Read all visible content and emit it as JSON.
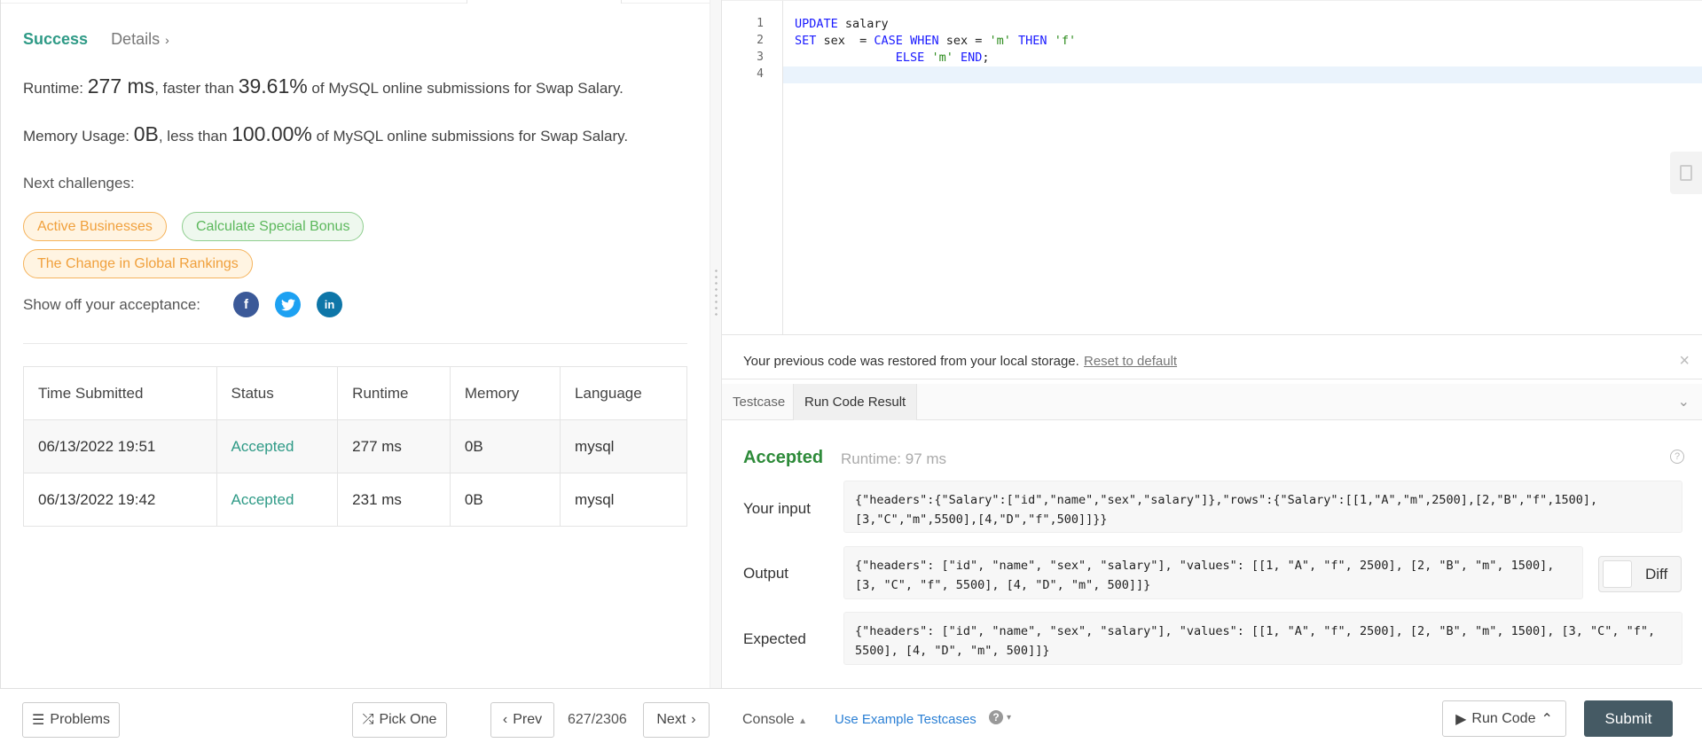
{
  "result": {
    "status": "Success",
    "details_label": "Details",
    "runtime_prefix": "Runtime: ",
    "runtime_value": "277 ms",
    "runtime_mid": ", faster than ",
    "runtime_pct": "39.61%",
    "runtime_suffix": " of MySQL online submissions for Swap Salary.",
    "memory_prefix": "Memory Usage: ",
    "memory_value": "0B",
    "memory_mid": ", less than ",
    "memory_pct": "100.00%",
    "memory_suffix": " of MySQL online submissions for Swap Salary."
  },
  "next_challenges": {
    "label": "Next challenges:",
    "items": [
      "Active Businesses",
      "Calculate Special Bonus",
      "The Change in Global Rankings"
    ]
  },
  "share": {
    "label": "Show off your acceptance:",
    "facebook": "f",
    "twitter": "t",
    "linkedin": "in"
  },
  "submissions": {
    "headers": [
      "Time Submitted",
      "Status",
      "Runtime",
      "Memory",
      "Language"
    ],
    "rows": [
      [
        "06/13/2022 19:51",
        "Accepted",
        "277 ms",
        "0B",
        "mysql"
      ],
      [
        "06/13/2022 19:42",
        "Accepted",
        "231 ms",
        "0B",
        "mysql"
      ]
    ]
  },
  "editor": {
    "line_numbers": [
      "1",
      "2",
      "3",
      "4"
    ]
  },
  "restore": {
    "text": "Your previous code was restored from your local storage.",
    "reset_label": "Reset to default",
    "close": "×"
  },
  "tabs": {
    "testcase": "Testcase",
    "result": "Run Code Result"
  },
  "run_result": {
    "status": "Accepted",
    "runtime": "Runtime: 97 ms",
    "help": "?",
    "input_label": "Your input",
    "input": "{\"headers\":{\"Salary\":[\"id\",\"name\",\"sex\",\"salary\"]},\"rows\":{\"Salary\":[[1,\"A\",\"m\",2500],[2,\"B\",\"f\",1500],[3,\"C\",\"m\",5500],[4,\"D\",\"f\",500]]}}",
    "output_label": "Output",
    "output": "{\"headers\": [\"id\", \"name\", \"sex\", \"salary\"], \"values\": [[1, \"A\", \"f\", 2500], [2, \"B\", \"m\", 1500], [3, \"C\", \"f\", 5500], [4, \"D\", \"m\", 500]]}",
    "expected_label": "Expected",
    "expected": "{\"headers\": [\"id\", \"name\", \"sex\", \"salary\"], \"values\": [[1, \"A\", \"f\", 2500], [2, \"B\", \"m\", 1500], [3, \"C\", \"f\", 5500], [4, \"D\", \"m\", 500]]}",
    "diff_label": "Diff"
  },
  "bottom": {
    "problems": "Problems",
    "pick_one": "Pick One",
    "prev": "Prev",
    "page": "627/2306",
    "next": "Next",
    "console": "Console",
    "example": "Use Example Testcases",
    "run": "Run Code",
    "submit": "Submit"
  },
  "colors": {
    "success": "#2e9a86",
    "accepted": "#2e8b3a",
    "submit_bg": "#455a64",
    "link": "#2a7fd4"
  }
}
